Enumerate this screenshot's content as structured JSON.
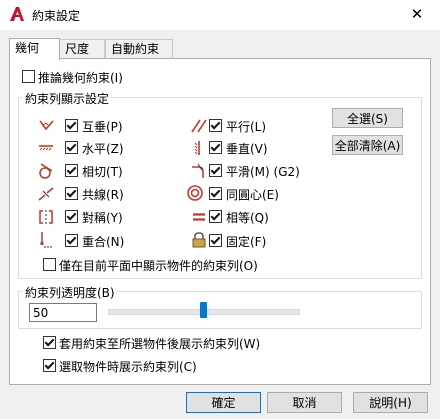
{
  "window": {
    "title": "約束設定",
    "close_glyph": "✕"
  },
  "tabs": [
    {
      "label": "幾何"
    },
    {
      "label": "尺度"
    },
    {
      "label": "自動約束"
    }
  ],
  "infer": {
    "label": "推論幾何約束(I)",
    "checked": false
  },
  "display_group": {
    "title": "約束列顯示設定",
    "items": [
      {
        "label": "互垂(P)",
        "icon": "perpendicular-icon",
        "checked": true
      },
      {
        "label": "平行(L)",
        "icon": "parallel-icon",
        "checked": true
      },
      {
        "label": "水平(Z)",
        "icon": "horizontal-icon",
        "checked": true
      },
      {
        "label": "垂直(V)",
        "icon": "vertical-icon",
        "checked": true
      },
      {
        "label": "相切(T)",
        "icon": "tangent-icon",
        "checked": true
      },
      {
        "label": "平滑(M) (G2)",
        "icon": "smooth-icon",
        "checked": true
      },
      {
        "label": "共線(R)",
        "icon": "collinear-icon",
        "checked": true
      },
      {
        "label": "同圓心(E)",
        "icon": "concentric-icon",
        "checked": true
      },
      {
        "label": "對稱(Y)",
        "icon": "symmetric-icon",
        "checked": true
      },
      {
        "label": "相等(Q)",
        "icon": "equal-icon",
        "checked": true
      },
      {
        "label": "重合(N)",
        "icon": "coincident-icon",
        "checked": true
      },
      {
        "label": "固定(F)",
        "icon": "fix-lock-icon",
        "checked": true
      }
    ],
    "select_all_label": "全選(S)",
    "clear_all_label": "全部清除(A)",
    "current_plane": {
      "label": "僅在目前平面中顯示物件的約束列(O)",
      "checked": false
    }
  },
  "transparency": {
    "title": "約束列透明度(B)",
    "value": "50",
    "slider_fraction": 0.5
  },
  "apply_after": {
    "label": "套用約束至所選物件後展示約束列(W)",
    "checked": true
  },
  "show_on_select": {
    "label": "選取物件時展示約束列(C)",
    "checked": true
  },
  "buttons": {
    "ok": "確定",
    "cancel": "取消",
    "help": "說明(H)"
  },
  "colors": {
    "accent": "#0078d7",
    "icon_red": "#c0392b",
    "brand_red": "#c8102e"
  }
}
